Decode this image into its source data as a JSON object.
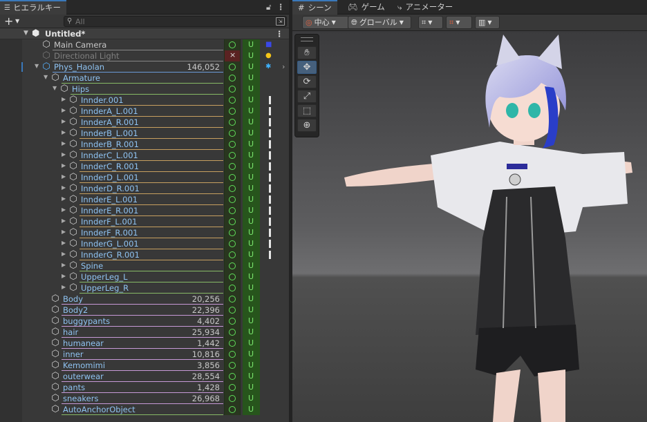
{
  "hierarchy": {
    "tab_label": "ヒエラルキー",
    "search_placeholder": "All",
    "scene_name": "Untitled*",
    "rows": [
      {
        "name": "Main Camera",
        "depth": 0,
        "arrow": "",
        "count": "",
        "col1": "o",
        "col3": "camera",
        "uline": "#888888",
        "style": ""
      },
      {
        "name": "Directional Light",
        "depth": 0,
        "arrow": "",
        "count": "",
        "col1": "x",
        "col3": "light",
        "uline": "#888888",
        "style": "dim"
      },
      {
        "name": "Phys_Haolan",
        "depth": 0,
        "arrow": "open",
        "count": "146,052",
        "col1": "o",
        "col3": "humanoid",
        "uline": "#6b9bd8",
        "style": "link",
        "cube": "blue",
        "chevron": true
      },
      {
        "name": "Armature",
        "depth": 1,
        "arrow": "open",
        "count": "",
        "col1": "o",
        "col3": "",
        "uline": "#88bb66",
        "style": "link"
      },
      {
        "name": "Hips",
        "depth": 2,
        "arrow": "open",
        "count": "",
        "col1": "o",
        "col3": "",
        "uline": "#88bb66",
        "style": "link"
      },
      {
        "name": "Innder.001",
        "depth": 3,
        "arrow": "closed",
        "count": "",
        "col1": "o",
        "col3": "bar",
        "uline": "#c8a060",
        "style": "link"
      },
      {
        "name": "InnderA_L.001",
        "depth": 3,
        "arrow": "closed",
        "count": "",
        "col1": "o",
        "col3": "bar",
        "uline": "#c8a060",
        "style": "link"
      },
      {
        "name": "InnderA_R.001",
        "depth": 3,
        "arrow": "closed",
        "count": "",
        "col1": "o",
        "col3": "bar",
        "uline": "#c8a060",
        "style": "link"
      },
      {
        "name": "InnderB_L.001",
        "depth": 3,
        "arrow": "closed",
        "count": "",
        "col1": "o",
        "col3": "bar",
        "uline": "#c8a060",
        "style": "link"
      },
      {
        "name": "InnderB_R.001",
        "depth": 3,
        "arrow": "closed",
        "count": "",
        "col1": "o",
        "col3": "bar",
        "uline": "#c8a060",
        "style": "link"
      },
      {
        "name": "InnderC_L.001",
        "depth": 3,
        "arrow": "closed",
        "count": "",
        "col1": "o",
        "col3": "bar",
        "uline": "#c8a060",
        "style": "link"
      },
      {
        "name": "InnderC_R.001",
        "depth": 3,
        "arrow": "closed",
        "count": "",
        "col1": "o",
        "col3": "bar",
        "uline": "#c8a060",
        "style": "link"
      },
      {
        "name": "InnderD_L.001",
        "depth": 3,
        "arrow": "closed",
        "count": "",
        "col1": "o",
        "col3": "bar",
        "uline": "#c8a060",
        "style": "link"
      },
      {
        "name": "InnderD_R.001",
        "depth": 3,
        "arrow": "closed",
        "count": "",
        "col1": "o",
        "col3": "bar",
        "uline": "#c8a060",
        "style": "link"
      },
      {
        "name": "InnderE_L.001",
        "depth": 3,
        "arrow": "closed",
        "count": "",
        "col1": "o",
        "col3": "bar",
        "uline": "#c8a060",
        "style": "link"
      },
      {
        "name": "InnderE_R.001",
        "depth": 3,
        "arrow": "closed",
        "count": "",
        "col1": "o",
        "col3": "bar",
        "uline": "#c8a060",
        "style": "link"
      },
      {
        "name": "InnderF_L.001",
        "depth": 3,
        "arrow": "closed",
        "count": "",
        "col1": "o",
        "col3": "bar",
        "uline": "#c8a060",
        "style": "link"
      },
      {
        "name": "InnderF_R.001",
        "depth": 3,
        "arrow": "closed",
        "count": "",
        "col1": "o",
        "col3": "bar",
        "uline": "#c8a060",
        "style": "link"
      },
      {
        "name": "InnderG_L.001",
        "depth": 3,
        "arrow": "closed",
        "count": "",
        "col1": "o",
        "col3": "bar",
        "uline": "#c8a060",
        "style": "link"
      },
      {
        "name": "InnderG_R.001",
        "depth": 3,
        "arrow": "closed",
        "count": "",
        "col1": "o",
        "col3": "bar",
        "uline": "#c8a060",
        "style": "link"
      },
      {
        "name": "Spine",
        "depth": 3,
        "arrow": "closed",
        "count": "",
        "col1": "o",
        "col3": "",
        "uline": "#88bb66",
        "style": "link"
      },
      {
        "name": "UpperLeg_L",
        "depth": 3,
        "arrow": "closed",
        "count": "",
        "col1": "o",
        "col3": "",
        "uline": "#88bb66",
        "style": "link"
      },
      {
        "name": "UpperLeg_R",
        "depth": 3,
        "arrow": "closed",
        "count": "",
        "col1": "o",
        "col3": "",
        "uline": "#88bb66",
        "style": "link"
      },
      {
        "name": "Body",
        "depth": 1,
        "arrow": "",
        "count": "20,256",
        "col1": "o",
        "col3": "",
        "uline": "#c89ad8",
        "style": "link"
      },
      {
        "name": "Body2",
        "depth": 1,
        "arrow": "",
        "count": "22,396",
        "col1": "o",
        "col3": "",
        "uline": "#c89ad8",
        "style": "link"
      },
      {
        "name": "buggypants",
        "depth": 1,
        "arrow": "",
        "count": "4,402",
        "col1": "o",
        "col3": "",
        "uline": "#c89ad8",
        "style": "link"
      },
      {
        "name": "hair",
        "depth": 1,
        "arrow": "",
        "count": "25,934",
        "col1": "o",
        "col3": "",
        "uline": "#c89ad8",
        "style": "link"
      },
      {
        "name": "humanear",
        "depth": 1,
        "arrow": "",
        "count": "1,442",
        "col1": "o",
        "col3": "",
        "uline": "#c89ad8",
        "style": "link"
      },
      {
        "name": "inner",
        "depth": 1,
        "arrow": "",
        "count": "10,816",
        "col1": "o",
        "col3": "",
        "uline": "#c89ad8",
        "style": "link"
      },
      {
        "name": "Kemomimi",
        "depth": 1,
        "arrow": "",
        "count": "3,856",
        "col1": "o",
        "col3": "",
        "uline": "#c89ad8",
        "style": "link"
      },
      {
        "name": "outerwear",
        "depth": 1,
        "arrow": "",
        "count": "28,554",
        "col1": "o",
        "col3": "",
        "uline": "#c89ad8",
        "style": "link"
      },
      {
        "name": "pants",
        "depth": 1,
        "arrow": "",
        "count": "1,428",
        "col1": "o",
        "col3": "",
        "uline": "#c89ad8",
        "style": "link"
      },
      {
        "name": "sneakers",
        "depth": 1,
        "arrow": "",
        "count": "26,968",
        "col1": "o",
        "col3": "",
        "uline": "#c89ad8",
        "style": "link"
      },
      {
        "name": "AutoAnchorObject",
        "depth": 1,
        "arrow": "",
        "count": "",
        "col1": "o",
        "col3": "",
        "uline": "#88bb66",
        "style": "link"
      }
    ]
  },
  "scene_view": {
    "tabs": [
      "シーン",
      "ゲーム",
      "アニメーター"
    ],
    "pivot_label": "中心",
    "space_label": "グローバル"
  }
}
